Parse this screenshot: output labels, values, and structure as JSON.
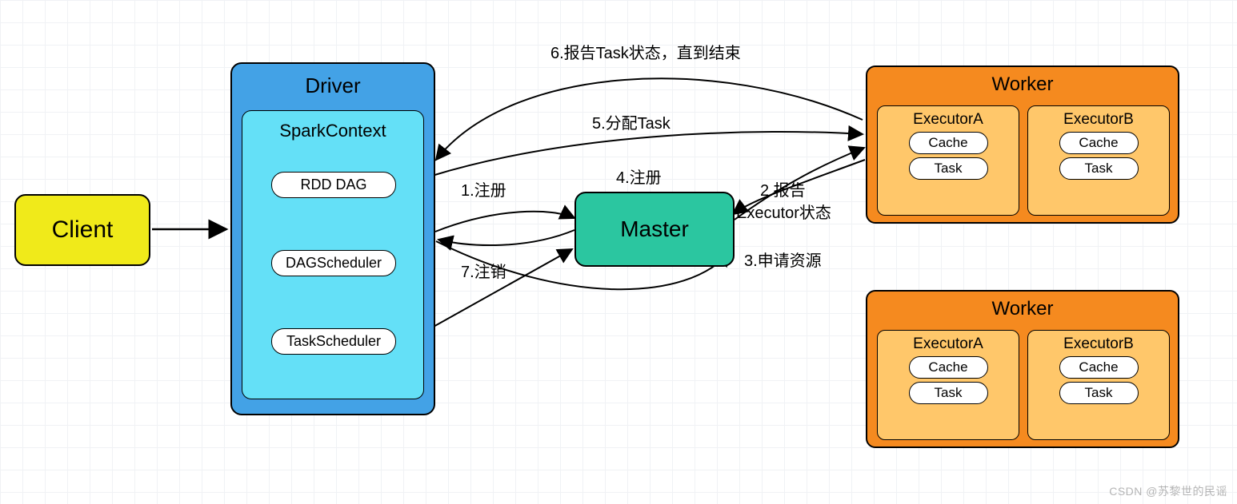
{
  "client": {
    "label": "Client"
  },
  "driver": {
    "title": "Driver",
    "sparkContext": {
      "title": "SparkContext",
      "items": [
        "RDD DAG",
        "DAGScheduler",
        "TaskScheduler"
      ]
    }
  },
  "master": {
    "label": "Master"
  },
  "workers": [
    {
      "title": "Worker",
      "executors": [
        {
          "title": "ExecutorA",
          "cache": "Cache",
          "task": "Task"
        },
        {
          "title": "ExecutorB",
          "cache": "Cache",
          "task": "Task"
        }
      ]
    },
    {
      "title": "Worker",
      "executors": [
        {
          "title": "ExecutorA",
          "cache": "Cache",
          "task": "Task"
        },
        {
          "title": "ExecutorB",
          "cache": "Cache",
          "task": "Task"
        }
      ]
    }
  ],
  "edges": {
    "e1": "1.注册",
    "e2_a": "2.报告",
    "e2_b": "Executor状态",
    "e3": "3.申请资源",
    "e4": "4.注册",
    "e5": "5.分配Task",
    "e6": "6.报告Task状态，直到结束",
    "e7": "7.注销"
  },
  "colors": {
    "client_bg": "#f0ea1a",
    "driver_bg": "#43a2e6",
    "spark_bg": "#64e0f7",
    "master_bg": "#2bc6a0",
    "worker_bg": "#f58a1f",
    "exec_bg": "#ffc76a"
  },
  "watermark": "CSDN @苏黎世的民谣"
}
